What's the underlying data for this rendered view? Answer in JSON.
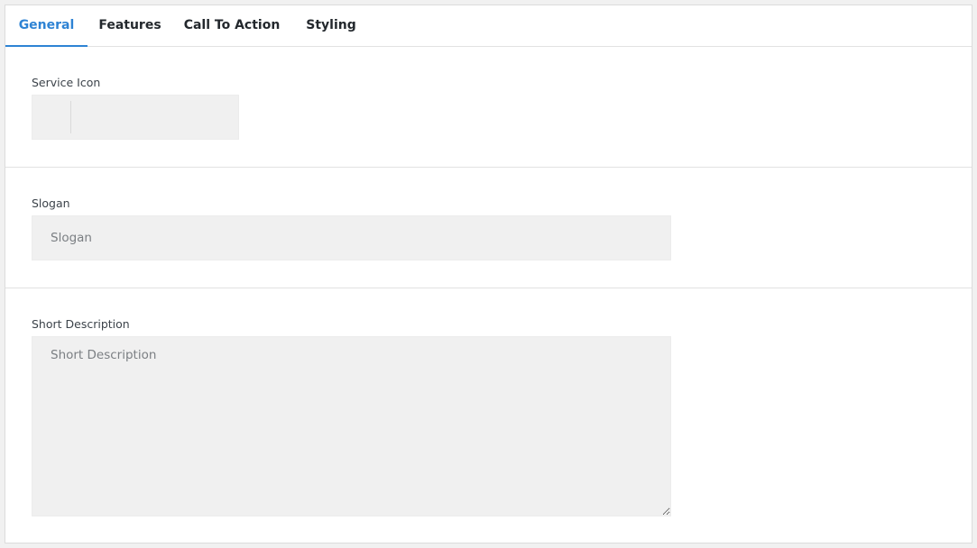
{
  "tabs": [
    {
      "label": "General",
      "active": true
    },
    {
      "label": "Features",
      "active": false
    },
    {
      "label": "Call To Action",
      "active": false
    },
    {
      "label": "Styling",
      "active": false
    }
  ],
  "fields": {
    "service_icon": {
      "label": "Service Icon"
    },
    "slogan": {
      "label": "Slogan",
      "placeholder": "Slogan",
      "value": ""
    },
    "short_description": {
      "label": "Short Description",
      "placeholder": "Short Description",
      "value": ""
    }
  },
  "colors": {
    "accent": "#2e83d4",
    "input_background": "#f0f0f0"
  }
}
